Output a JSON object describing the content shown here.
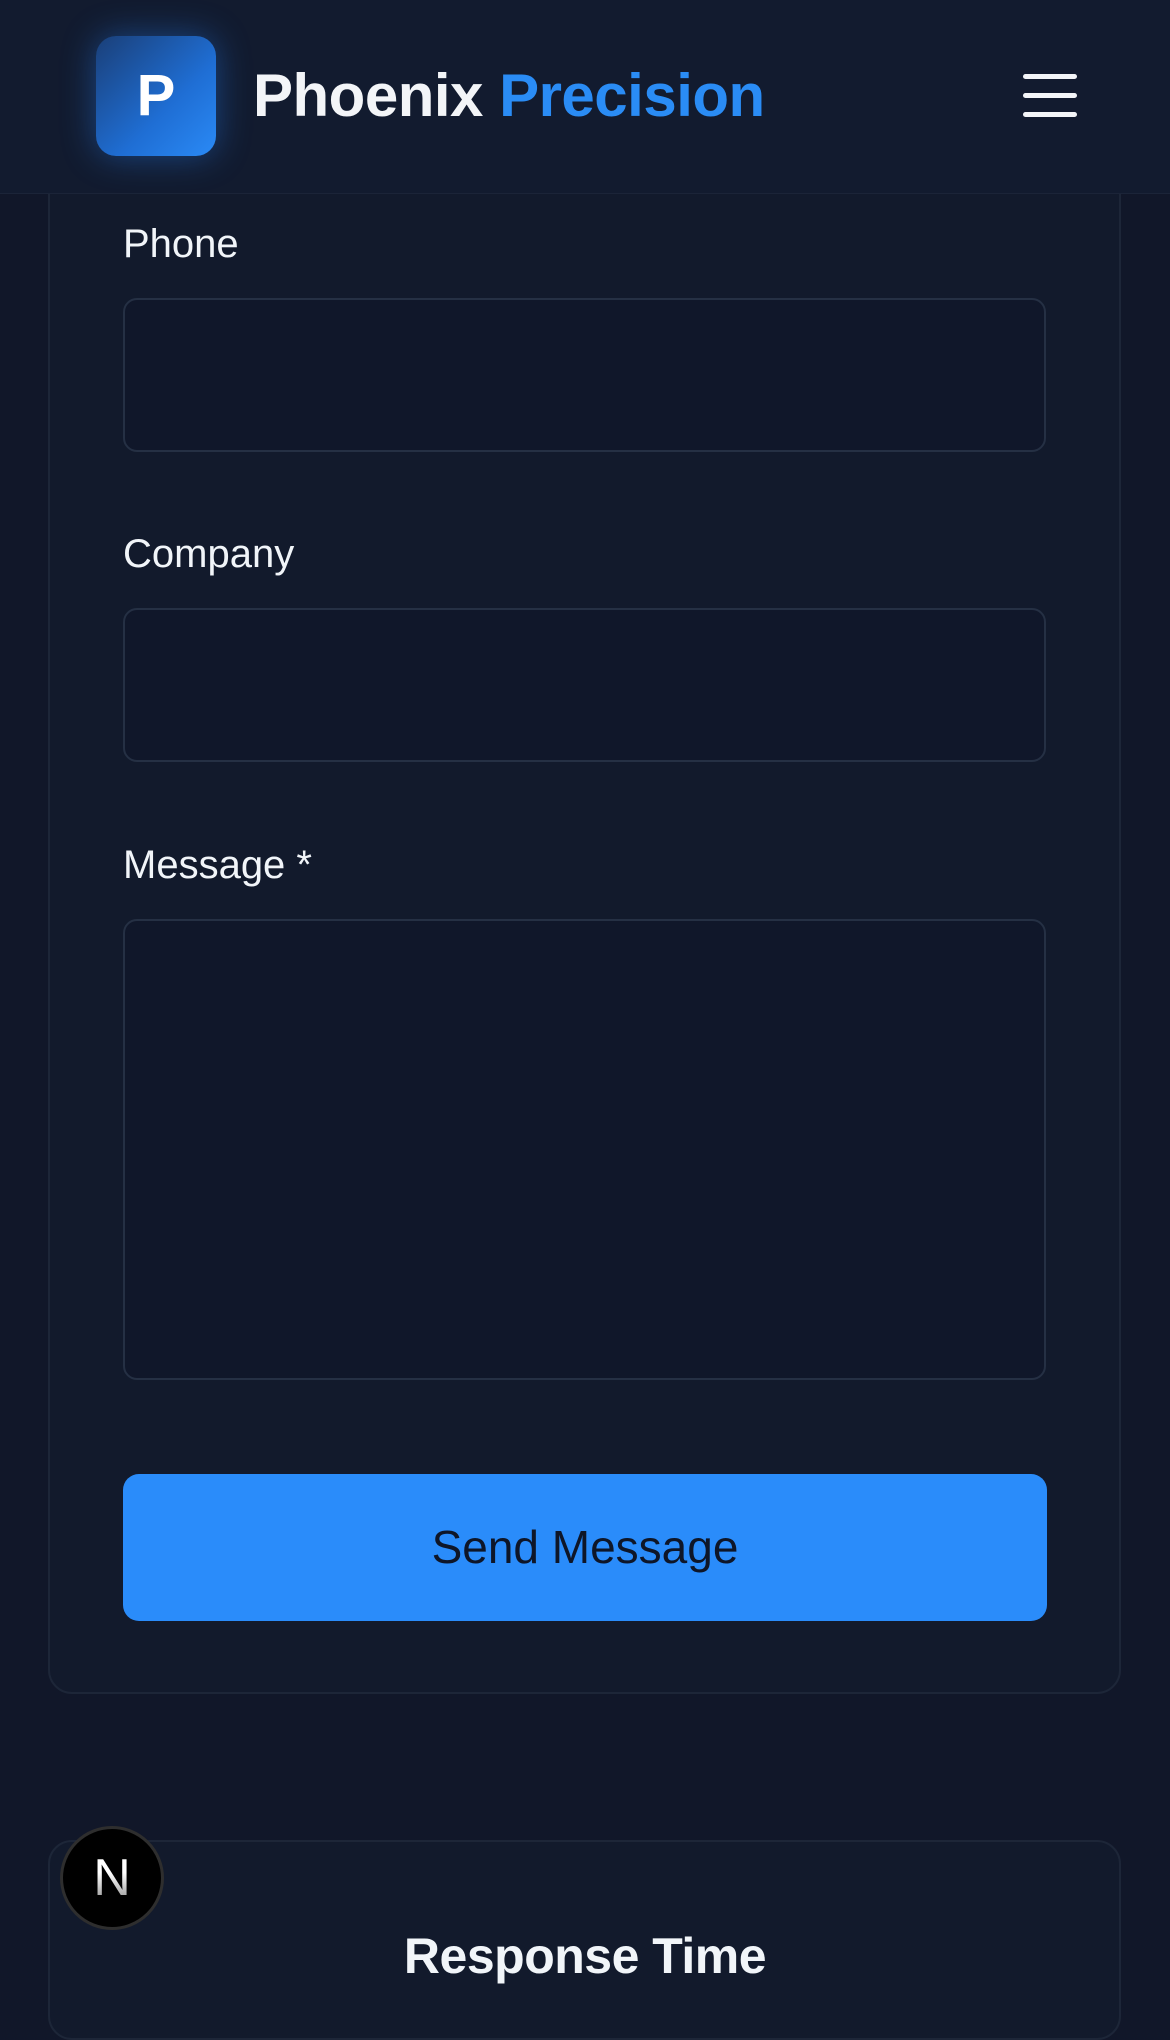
{
  "header": {
    "logo_letter": "P",
    "brand_primary": "Phoenix",
    "brand_accent": "Precision",
    "menu_icon": "hamburger-menu-icon"
  },
  "form": {
    "phone_label": "Phone",
    "phone_value": "",
    "company_label": "Company",
    "company_value": "",
    "message_label": "Message *",
    "message_value": "",
    "submit_label": "Send Message"
  },
  "response_card": {
    "title": "Response Time"
  },
  "badge": {
    "letter": "N",
    "icon": "next-js-badge-icon"
  },
  "colors": {
    "background": "#111729",
    "accent": "#2a8cfa",
    "card_border": "#1d2638"
  }
}
